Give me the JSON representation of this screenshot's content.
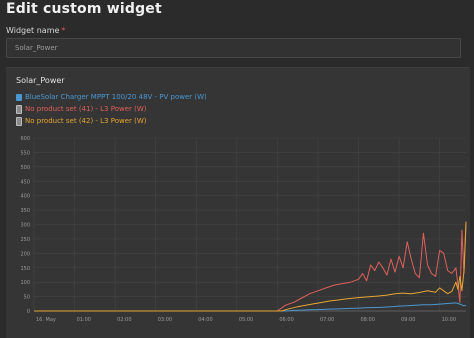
{
  "page": {
    "title": "Edit custom widget",
    "name_label": "Widget name",
    "required_marker": "*",
    "name_value": "Solar_Power"
  },
  "widget": {
    "title": "Solar_Power",
    "legend": [
      {
        "label": "BlueSolar Charger MPPT 100/20 48V - PV power (W)",
        "color": "#4a98d3",
        "icon": "square-icon"
      },
      {
        "label": "No product set (41) - L3 Power (W)",
        "color": "#e0605a",
        "icon": "battery-icon"
      },
      {
        "label": "No product set (42) - L3 Power (W)",
        "color": "#e8a531",
        "icon": "battery-icon"
      }
    ]
  },
  "chart_data": {
    "type": "line",
    "ylim": [
      0,
      600
    ],
    "yticks": [
      "0",
      "50",
      "100",
      "150",
      "200",
      "250",
      "300",
      "350",
      "400",
      "450",
      "500",
      "550",
      "600"
    ],
    "xticks": [
      "16. May",
      "01:00",
      "02:00",
      "03:00",
      "04:00",
      "05:00",
      "06:00",
      "07:00",
      "08:00",
      "09:00",
      "10:00"
    ],
    "xlim_hours": [
      0,
      10.65
    ],
    "grid": true,
    "series": [
      {
        "name": "BlueSolar Charger MPPT 100/20 48V - PV power (W)",
        "color": "#4a98d3",
        "x": [
          0,
          6.2,
          6.4,
          6.6,
          6.8,
          7.0,
          7.2,
          7.4,
          7.6,
          7.8,
          8.0,
          8.2,
          8.4,
          8.6,
          8.8,
          9.0,
          9.2,
          9.4,
          9.6,
          9.8,
          10.0,
          10.2,
          10.4,
          10.5,
          10.6,
          10.65
        ],
        "y": [
          0,
          0,
          2,
          3,
          4,
          5,
          6,
          7,
          8,
          9,
          10,
          11,
          12,
          13,
          15,
          17,
          18,
          20,
          22,
          22,
          24,
          26,
          28,
          24,
          18,
          20
        ]
      },
      {
        "name": "No product set (41) - L3 Power (W)",
        "color": "#e0605a",
        "x": [
          0,
          6.0,
          6.2,
          6.4,
          6.6,
          6.8,
          7.0,
          7.2,
          7.4,
          7.6,
          7.8,
          8.0,
          8.1,
          8.2,
          8.3,
          8.4,
          8.5,
          8.6,
          8.7,
          8.8,
          8.9,
          9.0,
          9.1,
          9.2,
          9.3,
          9.4,
          9.5,
          9.6,
          9.7,
          9.8,
          9.9,
          10.0,
          10.1,
          10.2,
          10.3,
          10.4,
          10.5,
          10.55,
          10.6,
          10.65
        ],
        "y": [
          0,
          0,
          20,
          30,
          45,
          60,
          70,
          80,
          90,
          95,
          100,
          110,
          130,
          105,
          160,
          140,
          170,
          150,
          125,
          180,
          135,
          190,
          150,
          240,
          180,
          130,
          115,
          270,
          160,
          130,
          120,
          210,
          200,
          140,
          130,
          150,
          30,
          280,
          130,
          300
        ]
      },
      {
        "name": "No product set (42) - L3 Power (W)",
        "color": "#e8a531",
        "x": [
          0,
          6.1,
          6.3,
          6.5,
          6.7,
          6.9,
          7.1,
          7.3,
          7.5,
          7.7,
          7.9,
          8.1,
          8.3,
          8.5,
          8.7,
          8.9,
          9.1,
          9.3,
          9.5,
          9.7,
          9.9,
          10.0,
          10.1,
          10.2,
          10.3,
          10.4,
          10.45,
          10.5,
          10.55,
          10.6,
          10.65
        ],
        "y": [
          0,
          0,
          8,
          15,
          20,
          25,
          30,
          35,
          38,
          42,
          45,
          48,
          50,
          52,
          55,
          60,
          62,
          60,
          64,
          70,
          65,
          80,
          70,
          60,
          68,
          100,
          75,
          120,
          70,
          140,
          310
        ]
      }
    ]
  }
}
